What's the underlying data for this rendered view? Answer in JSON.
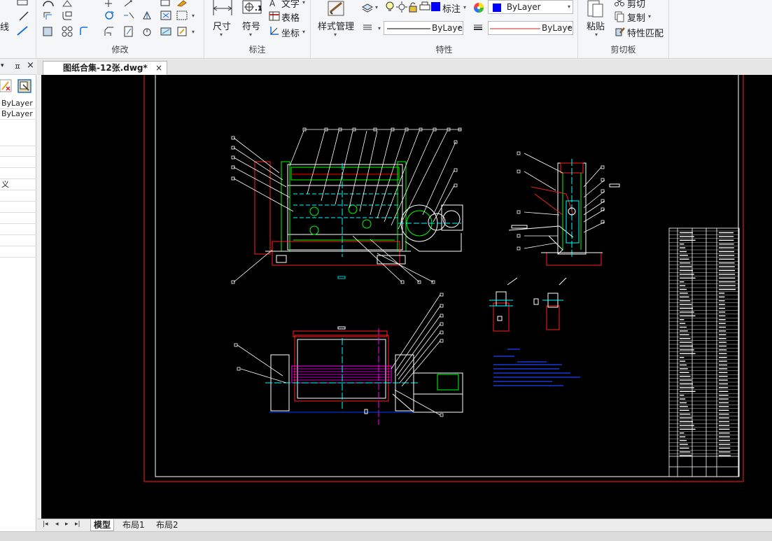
{
  "ribbon": {
    "draw_group": {
      "line_label": "线"
    },
    "modify_group": {
      "title": "修改"
    },
    "annotation_group": {
      "title": "标注",
      "dimension_label": "尺寸",
      "symbol_label": "符号",
      "text_label": "文字",
      "table_label": "表格",
      "coordinate_label": "坐标"
    },
    "properties_group": {
      "title": "特性",
      "style_manager_label": "样式管理",
      "text_style_value": "标注",
      "color_value": "ByLayer",
      "linetype_value": "ByLayer",
      "lineweight_value": "ByLayer"
    },
    "clipboard_group": {
      "title": "剪切板",
      "paste_label": "粘贴",
      "cut_label": "剪切",
      "copy_label": "复制",
      "match_label": "特性匹配"
    }
  },
  "properties_panel": {
    "rows": [
      "ByLayer",
      "ByLayer",
      "",
      "",
      "",
      "",
      "义",
      "",
      "",
      "",
      "",
      "",
      ""
    ]
  },
  "document": {
    "tab_title": "图纸合集-12张.dwg*",
    "close_glyph": "×"
  },
  "layout_tabs": {
    "nav": [
      "|◂",
      "◂",
      "▸",
      "▸|"
    ],
    "tabs": [
      {
        "label": "模型",
        "active": true
      },
      {
        "label": "布局1",
        "active": false
      },
      {
        "label": "布局2",
        "active": false
      }
    ]
  },
  "colors": {
    "canvas_bg": "#000000",
    "frame_red": "#ff2020",
    "frame_white": "#ffffff",
    "cad_cyan": "#00ffff",
    "cad_green": "#00ff00",
    "cad_magenta": "#ff00ff",
    "cad_blue": "#0000ff",
    "bylayer_blue": "#0000ff"
  },
  "icons": [
    "line-icon",
    "circle-icon",
    "move-icon",
    "rotate-icon",
    "dimension-icon",
    "symbol-icon",
    "text-icon",
    "table-icon",
    "coordinate-icon",
    "style-manager-icon",
    "lightbulb-icon",
    "sun-icon",
    "lock-icon",
    "printer-icon",
    "color-wheel-icon",
    "paste-icon",
    "scissors-icon",
    "copy-icon",
    "match-properties-icon"
  ]
}
